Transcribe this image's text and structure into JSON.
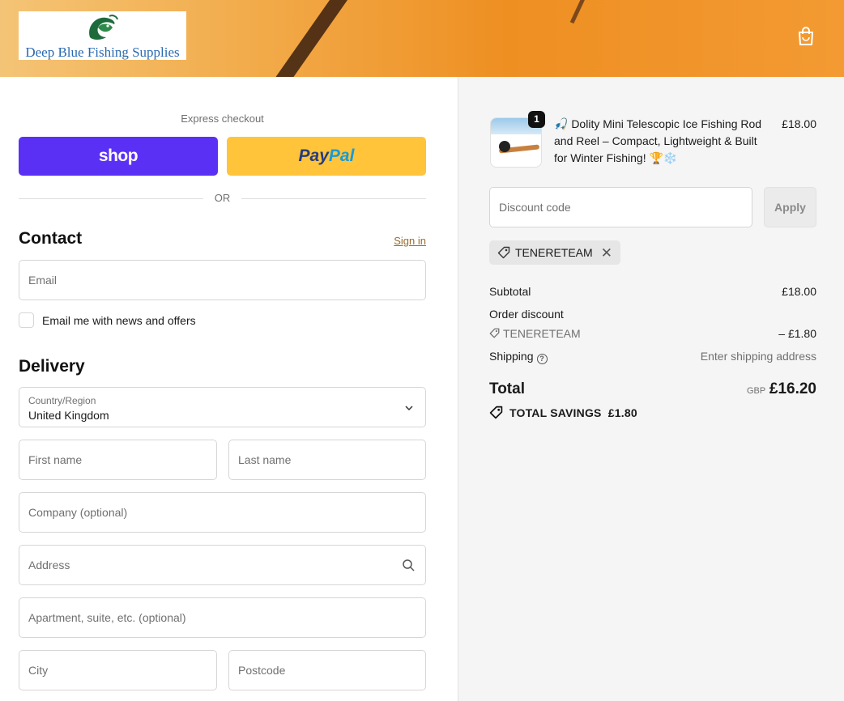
{
  "header": {
    "store_name": "Deep Blue Fishing Supplies",
    "cart_icon": "shopping-bag-icon"
  },
  "express": {
    "label": "Express checkout",
    "shop_label": "shop",
    "paypal_pay": "Pay",
    "paypal_pal": "Pal",
    "or_label": "OR"
  },
  "contact": {
    "title": "Contact",
    "sign_in": "Sign in",
    "email_placeholder": "Email",
    "newsletter_label": "Email me with news and offers",
    "newsletter_checked": false
  },
  "delivery": {
    "title": "Delivery",
    "country_label": "Country/Region",
    "country_value": "United Kingdom",
    "first_name_placeholder": "First name",
    "last_name_placeholder": "Last name",
    "company_placeholder": "Company (optional)",
    "address_placeholder": "Address",
    "apartment_placeholder": "Apartment, suite, etc. (optional)",
    "city_placeholder": "City",
    "postcode_placeholder": "Postcode"
  },
  "order": {
    "item": {
      "quantity": "1",
      "title": "🎣 Dolity Mini Telescopic Ice Fishing Rod and Reel – Compact, Lightweight & Built for Winter Fishing! 🏆❄️",
      "price": "£18.00"
    },
    "discount_placeholder": "Discount code",
    "apply_label": "Apply",
    "applied_code": "TENERETEAM",
    "subtotal_label": "Subtotal",
    "subtotal_value": "£18.00",
    "order_discount_label": "Order discount",
    "discount_code_label": "TENERETEAM",
    "discount_value": "– £1.80",
    "shipping_label": "Shipping",
    "shipping_value": "Enter shipping address",
    "total_label": "Total",
    "currency": "GBP",
    "total_value": "£16.20",
    "savings_label": "TOTAL SAVINGS",
    "savings_value": "£1.80"
  },
  "colors": {
    "shop_purple": "#5a31f4",
    "paypal_yellow": "#ffc43a",
    "link_brown": "#9b6b2b"
  }
}
